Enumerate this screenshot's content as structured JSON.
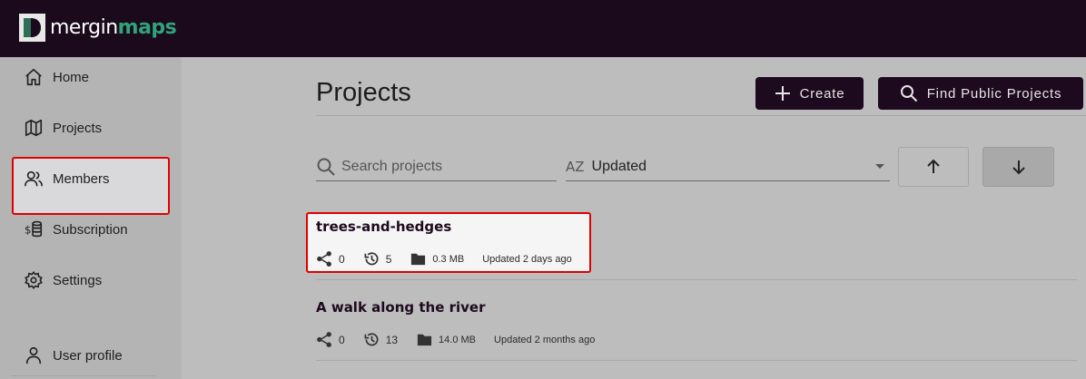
{
  "app": {
    "logo_part1": "mergin",
    "logo_part2": "maps"
  },
  "sidebar": {
    "items": [
      {
        "label": "Home",
        "icon": "home-icon"
      },
      {
        "label": "Projects",
        "icon": "map-icon",
        "active": true
      },
      {
        "label": "Members",
        "icon": "users-icon"
      },
      {
        "label": "Subscription",
        "icon": "coins-icon"
      },
      {
        "label": "Settings",
        "icon": "gear-icon"
      },
      {
        "label": "User profile",
        "icon": "user-icon"
      }
    ]
  },
  "main": {
    "title": "Projects",
    "create_label": "Create",
    "find_label": "Find Public Projects",
    "search": {
      "placeholder": "Search projects"
    },
    "sort": {
      "prefix": "AZ",
      "value": "Updated"
    }
  },
  "projects": [
    {
      "name": "trees-and-hedges",
      "shared": "0",
      "versions": "5",
      "size": "0.3 MB",
      "updated": "Updated 2 days ago"
    },
    {
      "name": "A walk along the river",
      "shared": "0",
      "versions": "13",
      "size": "14.0 MB",
      "updated": "Updated 2 months ago"
    }
  ],
  "colors": {
    "topbar": "#1b0a1c",
    "accent": "#2fa37a",
    "highlight": "#e00000"
  }
}
